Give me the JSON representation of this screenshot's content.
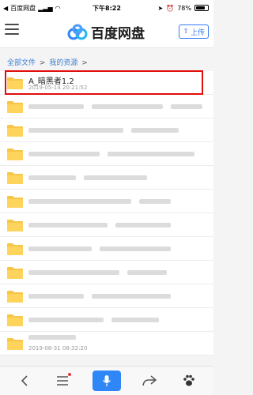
{
  "status_bar": {
    "carrier": "百度网盘",
    "time": "下午8:22",
    "battery": "78%",
    "battery_level": 0.78
  },
  "header": {
    "app_name": "百度网盘",
    "upload_label": "上传"
  },
  "breadcrumb": {
    "items": [
      "全部文件",
      "我的资源"
    ],
    "separator": ">"
  },
  "files": [
    {
      "name": "A_暗黑者1.2",
      "date": "2019-05-14 20:21:52",
      "highlighted": true
    },
    {
      "name": "",
      "date": ""
    },
    {
      "name": "",
      "date": ""
    },
    {
      "name": "",
      "date": ""
    },
    {
      "name": "",
      "date": ""
    },
    {
      "name": "",
      "date": ""
    },
    {
      "name": "",
      "date": ""
    },
    {
      "name": "",
      "date": ""
    },
    {
      "name": "",
      "date": ""
    },
    {
      "name": "",
      "date": ""
    },
    {
      "name": "",
      "date": ""
    },
    {
      "name": "",
      "date": "2019-08-31 08:32:20"
    }
  ],
  "colors": {
    "accent": "#3478f6",
    "highlight": "#e20d0d",
    "folder": "#f7c547"
  }
}
